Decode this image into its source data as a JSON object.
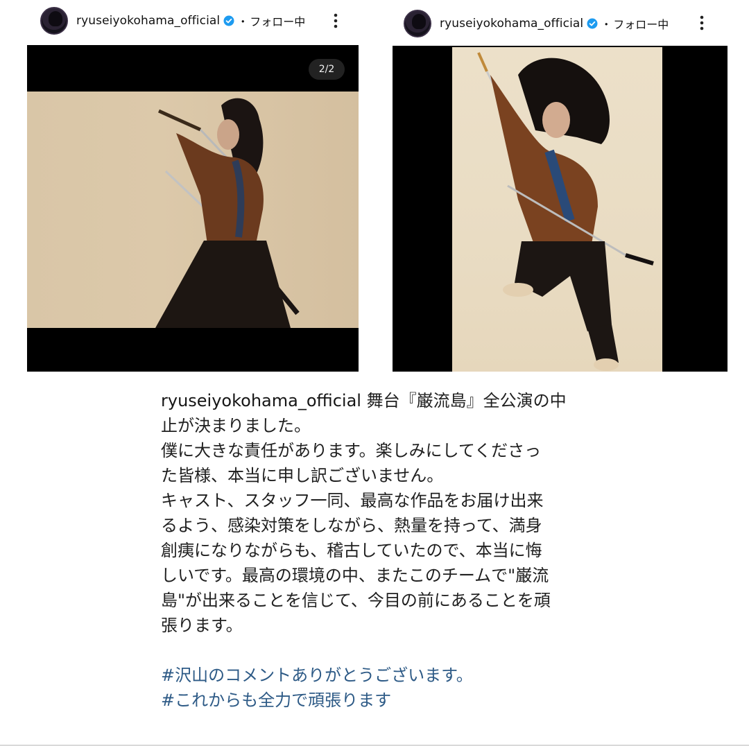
{
  "posts": [
    {
      "username": "ryuseiyokohama_official",
      "separator": "・",
      "follow_label": "フォロー中",
      "verified_icon": "verified-badge-icon",
      "more_icon": "more-vertical-icon",
      "carousel_counter": "2/2"
    },
    {
      "username": "ryuseiyokohama_official",
      "separator": "・",
      "follow_label": "フォロー中",
      "verified_icon": "verified-badge-icon",
      "more_icon": "more-vertical-icon"
    }
  ],
  "caption": {
    "username": "ryuseiyokohama_official",
    "lines": [
      " 舞台『巌流島』全公演の中",
      "止が決まりました。",
      "僕に大きな責任があります。楽しみにしてくださっ",
      "た皆様、本当に申し訳ございません。",
      "キャスト、スタッフ一同、最高な作品をお届け出来",
      "るよう、感染対策をしながら、熱量を持って、満身",
      "創痍になりながらも、稽古していたので、本当に悔",
      "しいです。最高の環境の中、またこのチームで\"巌流",
      "島\"が出来ることを信じて、今目の前にあることを頑",
      "張ります。"
    ],
    "hashtags": [
      "#沢山のコメントありがとうございます。",
      "#これからも全力で頑張ります"
    ]
  },
  "colors": {
    "verified_blue": "#1d9bf0",
    "hashtag_blue": "#2d5a86",
    "photo_backdrop": "#000000"
  }
}
